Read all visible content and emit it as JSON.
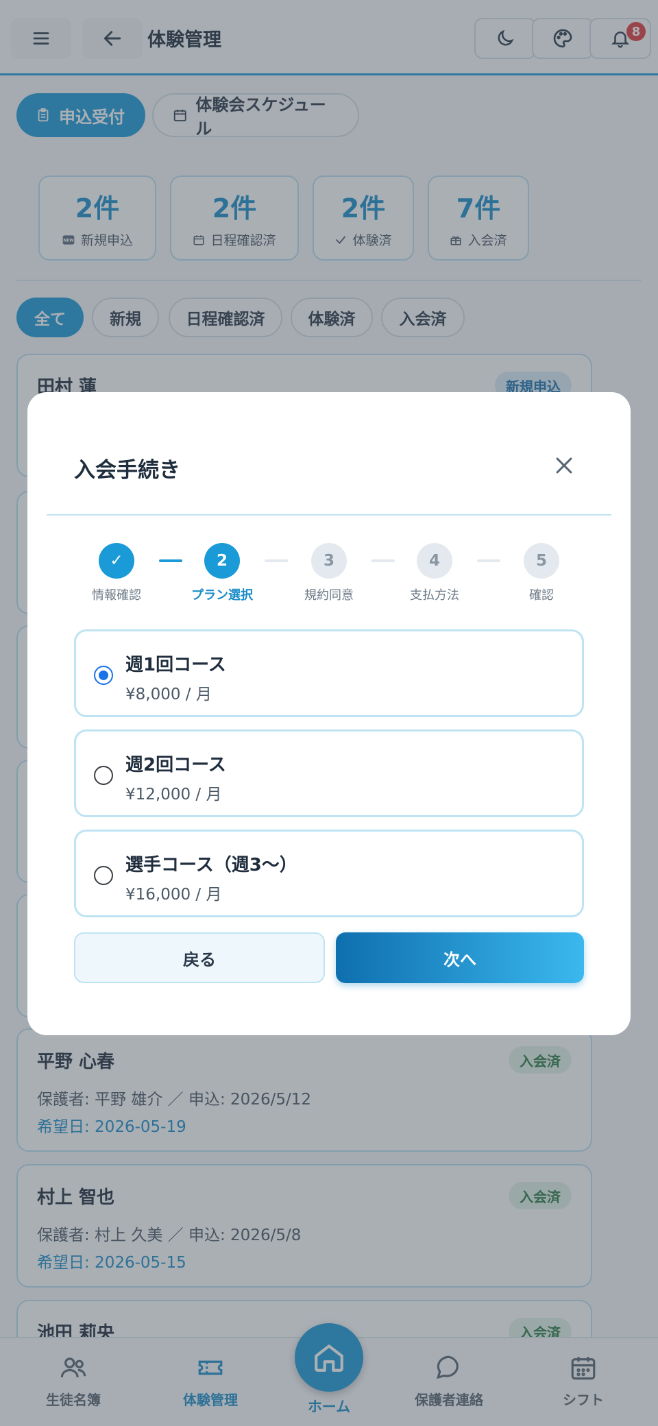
{
  "header": {
    "title": "体験管理",
    "notification_count": "8"
  },
  "tabs": [
    {
      "label": "申込受付"
    },
    {
      "label": "体験会スケジュール"
    }
  ],
  "stats": [
    {
      "value": "2件",
      "label": "新規申込"
    },
    {
      "value": "2件",
      "label": "日程確認済"
    },
    {
      "value": "2件",
      "label": "体験済"
    },
    {
      "value": "7件",
      "label": "入会済"
    }
  ],
  "filters": [
    {
      "label": "全て"
    },
    {
      "label": "新規"
    },
    {
      "label": "日程確認済"
    },
    {
      "label": "体験済"
    },
    {
      "label": "入会済"
    }
  ],
  "list": [
    {
      "name": "田村 蓮",
      "status": "新規申込"
    },
    {
      "name": "平野 心春",
      "status": "入会済",
      "meta": "保護者: 平野 雄介 ／ 申込: 2026/5/12",
      "date": "希望日: 2026-05-19"
    },
    {
      "name": "村上 智也",
      "status": "入会済",
      "meta": "保護者: 村上 久美 ／ 申込: 2026/5/8",
      "date": "希望日: 2026-05-15"
    },
    {
      "name": "池田 莉央",
      "status": "入会済"
    }
  ],
  "modal": {
    "title": "入会手続き",
    "steps": [
      {
        "num": "✓",
        "label": "情報確認"
      },
      {
        "num": "2",
        "label": "プラン選択"
      },
      {
        "num": "3",
        "label": "規約同意"
      },
      {
        "num": "4",
        "label": "支払方法"
      },
      {
        "num": "5",
        "label": "確認"
      }
    ],
    "plans": [
      {
        "name": "週1回コース",
        "price": "¥8,000 / 月",
        "selected": true
      },
      {
        "name": "週2回コース",
        "price": "¥12,000 / 月",
        "selected": false
      },
      {
        "name": "選手コース（週3〜）",
        "price": "¥16,000 / 月",
        "selected": false
      }
    ],
    "back_label": "戻る",
    "next_label": "次へ"
  },
  "bottom_nav": [
    {
      "label": "生徒名簿"
    },
    {
      "label": "体験管理"
    },
    {
      "label": "ホーム"
    },
    {
      "label": "保護者連絡"
    },
    {
      "label": "シフト"
    }
  ],
  "colors": {
    "accent": "#1a9ad7",
    "badge_red": "#e0393e",
    "enrolled_green": "#2d7a48"
  }
}
